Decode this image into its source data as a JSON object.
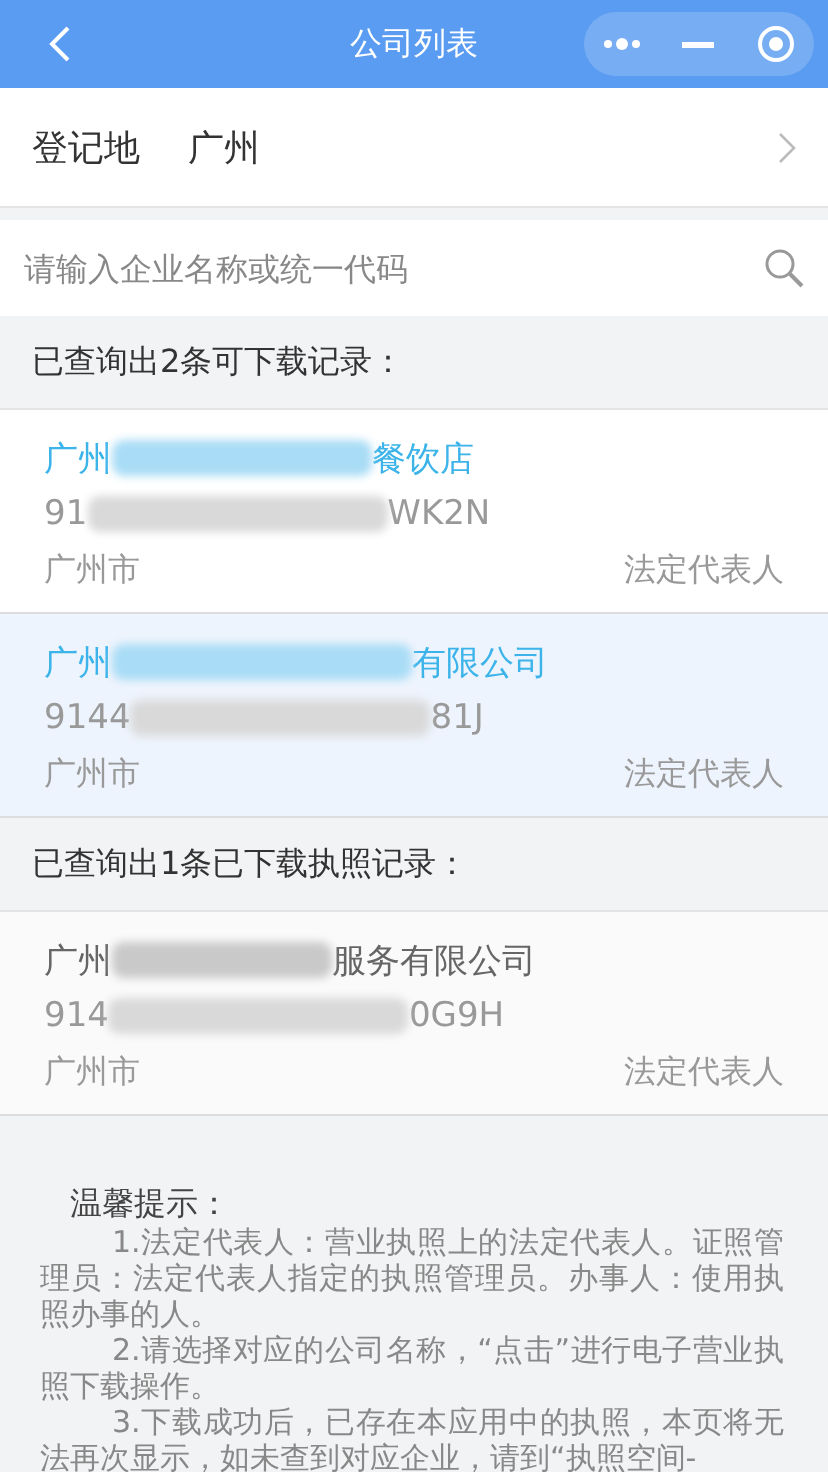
{
  "header": {
    "title": "公司列表"
  },
  "region": {
    "label": "登记地",
    "value": "广州"
  },
  "search": {
    "placeholder": "请输入企业名称或统一代码"
  },
  "sections": [
    {
      "heading": "已查询出2条可下载记录：",
      "downloaded": false,
      "companies": [
        {
          "name_start": "广州",
          "name_end": "餐饮店",
          "code_start": "91",
          "code_end": "WK2N",
          "city": "广州市",
          "role": "法定代表人",
          "selected": false
        },
        {
          "name_start": "广州",
          "name_end": "有限公司",
          "code_start": "9144",
          "code_end": "81J",
          "city": "广州市",
          "role": "法定代表人",
          "selected": true
        }
      ]
    },
    {
      "heading": "已查询出1条已下载执照记录：",
      "downloaded": true,
      "companies": [
        {
          "name_start": "广州",
          "name_end": "服务有限公司",
          "code_start": "914",
          "code_end": "0G9H",
          "city": "广州市",
          "role": "法定代表人",
          "selected": false
        }
      ]
    }
  ],
  "tips": {
    "title": "温馨提示：",
    "items": [
      "1.法定代表人：营业执照上的法定代表人。证照管理员：法定代表人指定的执照管理员。办事人：使用执照办事的人。",
      "2.请选择对应的公司名称，“点击”进行电子营业执照下载操作。",
      "3.下载成功后，已存在本应用中的执照，本页将无法再次显示，如未查到对应企业，请到“执照空间-"
    ]
  }
}
